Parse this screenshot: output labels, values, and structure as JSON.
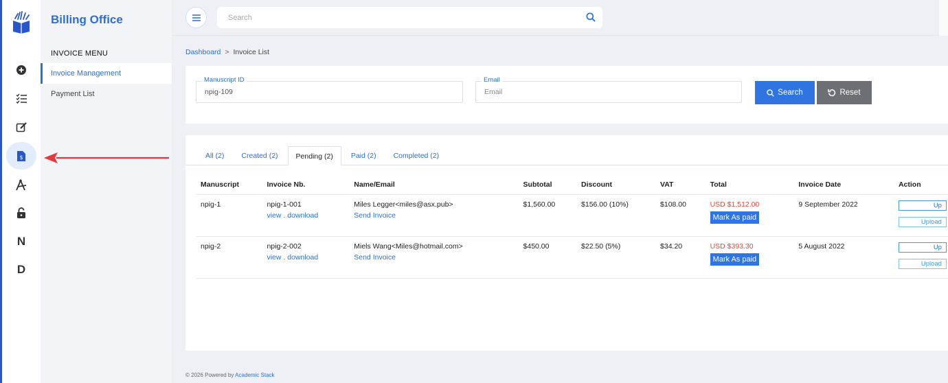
{
  "app": {
    "title": "Billing Office"
  },
  "menu": {
    "heading": "INVOICE MENU",
    "items": [
      {
        "label": "Invoice Management",
        "active": true
      },
      {
        "label": "Payment List",
        "active": false
      }
    ]
  },
  "rail": {
    "icons": [
      "plus-circle-icon",
      "checklist-icon",
      "edit-icon",
      "invoice-icon",
      "tools-icon",
      "unlock-icon"
    ],
    "letters": [
      "N",
      "D"
    ]
  },
  "search": {
    "placeholder": "Search"
  },
  "breadcrumb": {
    "root": "Dashboard",
    "sep": ">",
    "current": "Invoice List"
  },
  "filter": {
    "manuscript_label": "Manuscript ID",
    "manuscript_value": "npig-109",
    "email_label": "Email",
    "email_placeholder": "Email",
    "search_label": "Search",
    "reset_label": "Reset"
  },
  "tabs": [
    {
      "label": "All (2)"
    },
    {
      "label": "Created (2)"
    },
    {
      "label": "Pending (2)",
      "active": true
    },
    {
      "label": "Paid (2)"
    },
    {
      "label": "Completed (2)"
    }
  ],
  "table": {
    "headers": [
      "Manuscript",
      "Invoice Nb.",
      "Name/Email",
      "Subtotal",
      "Discount",
      "VAT",
      "Total",
      "Invoice Date",
      "Action"
    ],
    "rows": [
      {
        "manuscript": "npig-1",
        "invoice_nb": "npig-1-001",
        "view": "view",
        "dot": " . ",
        "download": "download",
        "name_email": "Miles Legger<miles@asx.pub>",
        "send": "Send Invoice",
        "subtotal": "$1,560.00",
        "discount": "$156.00 (10%)",
        "vat": "$108.00",
        "total": "USD $1,512.00",
        "mark": "Mark As paid",
        "date": "9 September 2022",
        "action1": "Up",
        "action2": "Upload"
      },
      {
        "manuscript": "npig-2",
        "invoice_nb": "npig-2-002",
        "view": "view",
        "dot": " . ",
        "download": "download",
        "name_email": "Miels Wang<Miles@hotmail.com>",
        "send": "Send Invoice",
        "subtotal": "$450.00",
        "discount": "$22.50 (5%)",
        "vat": "$34.20",
        "total": "USD $393.30",
        "mark": "Mark As paid",
        "date": "5 August 2022",
        "action1": "Up",
        "action2": "Upload"
      }
    ]
  },
  "footer": {
    "text": "© 2026 Powered by ",
    "link": "Academic Stack"
  },
  "colors": {
    "accent": "#2d6fd3",
    "button": "#2f74e0",
    "reset": "#6c7075",
    "total": "#e2483b",
    "arrow": "#e0393e"
  }
}
